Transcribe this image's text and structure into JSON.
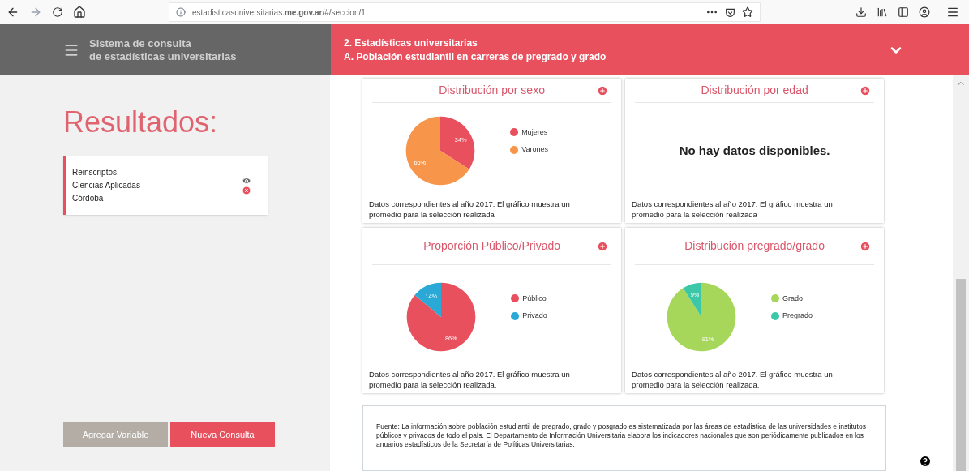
{
  "browser": {
    "address": "estadisticasuniversitarias.**me.gov.ar**/#/seccion/1"
  },
  "header": {
    "app_title": [
      "Sistema de consulta",
      "de estadísticas universitarias"
    ],
    "section_lines": [
      "2. Estadísticas universitarias",
      "A. Población estudiantil en carreras de pregrado y grado"
    ]
  },
  "sidebar": {
    "title": "Resultados:",
    "result": {
      "lines": [
        "Reinscriptos",
        "Ciencias Aplicadas",
        "Córdoba"
      ]
    },
    "buttons": [
      {
        "label": "Agregar Variable",
        "kind": "secondary"
      },
      {
        "label": "Nueva Consulta",
        "kind": "primary"
      }
    ]
  },
  "cards": [
    {
      "title": "Distribución por sexo",
      "kind": "chart",
      "legend": [
        {
          "color": "#e9505e"
        },
        {
          "color": "#f7964a"
        }
      ],
      "chart_data": {
        "type": "pie",
        "categories": [
          "Mujeres",
          "Varones"
        ],
        "values": [
          34,
          66
        ],
        "value_labels": [
          "34%",
          "66%"
        ]
      },
      "note": "Datos correspondientes al año 2017. El gráfico muestra un promedio para la selección realizada"
    },
    {
      "title": "Distribución por edad",
      "kind": "empty",
      "message": "No hay datos disponibles.",
      "note": "Datos correspondientes al año 2017. El gráfico muestra un promedio para la selección realizada"
    },
    {
      "title": "Proporción Público/Privado",
      "kind": "chart",
      "legend": [
        {
          "color": "#e9505e"
        },
        {
          "color": "#2aa8d6"
        }
      ],
      "chart_data": {
        "type": "pie",
        "categories": [
          "Público",
          "Privado"
        ],
        "values": [
          86,
          14
        ],
        "value_labels": [
          "86%",
          "14%"
        ]
      },
      "note": "Datos correspondientes al año 2017. El gráfico muestra un promedio para la selección realizada."
    },
    {
      "title": "Distribución pregrado/grado",
      "kind": "chart",
      "legend": [
        {
          "color": "#a6d75b"
        },
        {
          "color": "#3cc8a8"
        }
      ],
      "chart_data": {
        "type": "pie",
        "categories": [
          "Grado",
          "Pregrado"
        ],
        "values": [
          91,
          9
        ],
        "value_labels": [
          "91%",
          "9%"
        ]
      },
      "note": "Datos correspondientes al año 2017. El gráfico muestra un promedio para la selección realizada."
    }
  ],
  "source": "Fuente: La información sobre población estudiantil de pregrado, grado y posgrado es sistematizada por las áreas de estadística de las universidades e institutos públicos y privados de todo el país. El Departamento de Información Universitaria elabora los indicadores nacionales que son periódicamente publicados en los anuarios estadísticos de la Secretaría de Políticas Universitarias."
}
